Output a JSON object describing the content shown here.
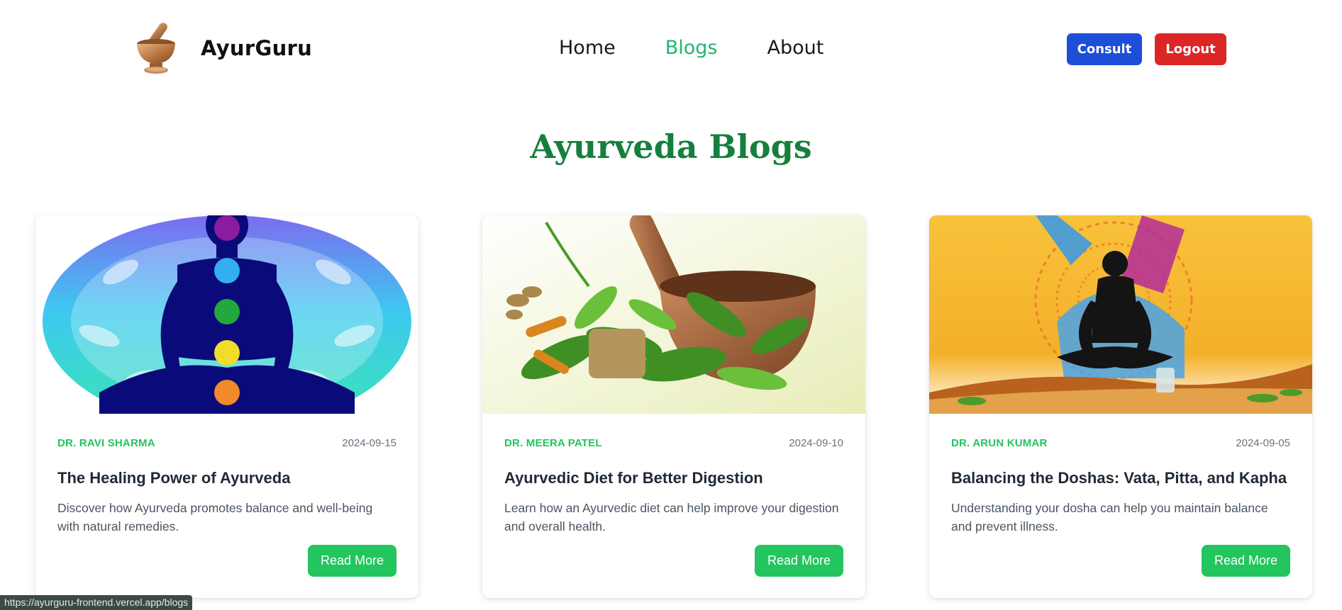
{
  "brand": {
    "name": "AyurGuru",
    "logo_icon": "mortar-pestle-icon"
  },
  "nav": {
    "links": [
      {
        "label": "Home",
        "active": false
      },
      {
        "label": "Blogs",
        "active": true
      },
      {
        "label": "About",
        "active": false
      }
    ],
    "consult_label": "Consult",
    "logout_label": "Logout"
  },
  "page": {
    "heading": "Ayurveda Blogs"
  },
  "blogs": [
    {
      "image": "chakra-meditation-image",
      "author": "DR. RAVI SHARMA",
      "date": "2024-09-15",
      "title": "The Healing Power of Ayurveda",
      "description": "Discover how Ayurveda promotes balance and well-being with natural remedies.",
      "button_label": "Read More"
    },
    {
      "image": "herbs-mortar-image",
      "author": "DR. MEERA PATEL",
      "date": "2024-09-10",
      "title": "Ayurvedic Diet for Better Digestion",
      "description": "Learn how an Ayurvedic diet can help improve your digestion and overall health.",
      "button_label": "Read More"
    },
    {
      "image": "yoga-silhouette-image",
      "author": "DR. ARUN KUMAR",
      "date": "2024-09-05",
      "title": "Balancing the Doshas: Vata, Pitta, and Kapha",
      "description": "Understanding your dosha can help you maintain balance and prevent illness.",
      "button_label": "Read More"
    }
  ],
  "status_bar": {
    "url": "https://ayurguru-frontend.vercel.app/blogs"
  },
  "colors": {
    "accent_green": "#22c55e",
    "heading_green": "#15803d",
    "consult_blue": "#1d4ed8",
    "logout_red": "#dc2626",
    "nav_active": "#22b573"
  }
}
